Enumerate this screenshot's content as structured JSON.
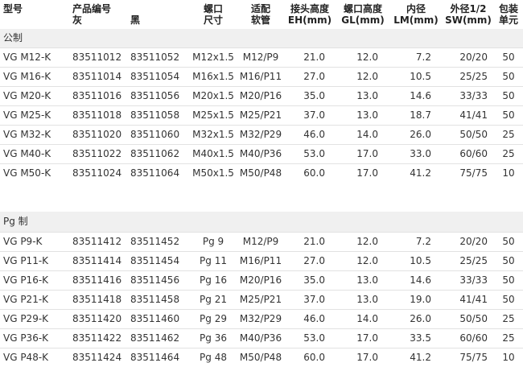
{
  "header": {
    "model": "型号",
    "code_title": "产品编号",
    "grey": "灰",
    "black": "黑",
    "thread_top": "螺口",
    "thread_bottom": "尺寸",
    "hose_top": "适配",
    "hose_bottom": "软管",
    "eh_top": "接头高度",
    "eh_bottom": "EH(mm)",
    "gl_top": "螺口高度",
    "gl_bottom": "GL(mm)",
    "lm_top": "内径",
    "lm_bottom": "LM(mm)",
    "sw_top": "外径1/2",
    "sw_bottom": "SW(mm)",
    "pack_top": "包装",
    "pack_bottom": "单元"
  },
  "sections": [
    {
      "title": "公制",
      "rows": [
        [
          "VG M12-K",
          "83511012",
          "83511052",
          "M12x1.5",
          "M12/P9",
          "21.0",
          "12.0",
          "7.2",
          "20/20",
          "50"
        ],
        [
          "VG M16-K",
          "83511014",
          "83511054",
          "M16x1.5",
          "M16/P11",
          "27.0",
          "12.0",
          "10.5",
          "25/25",
          "50"
        ],
        [
          "VG M20-K",
          "83511016",
          "83511056",
          "M20x1.5",
          "M20/P16",
          "35.0",
          "13.0",
          "14.6",
          "33/33",
          "50"
        ],
        [
          "VG M25-K",
          "83511018",
          "83511058",
          "M25x1.5",
          "M25/P21",
          "37.0",
          "13.0",
          "18.7",
          "41/41",
          "50"
        ],
        [
          "VG M32-K",
          "83511020",
          "83511060",
          "M32x1.5",
          "M32/P29",
          "46.0",
          "14.0",
          "26.0",
          "50/50",
          "25"
        ],
        [
          "VG M40-K",
          "83511022",
          "83511062",
          "M40x1.5",
          "M40/P36",
          "53.0",
          "17.0",
          "33.0",
          "60/60",
          "25"
        ],
        [
          "VG M50-K",
          "83511024",
          "83511064",
          "M50x1.5",
          "M50/P48",
          "60.0",
          "17.0",
          "41.2",
          "75/75",
          "10"
        ]
      ]
    },
    {
      "title": "Pg 制",
      "rows": [
        [
          "VG P9-K",
          "83511412",
          "83511452",
          "Pg 9",
          "M12/P9",
          "21.0",
          "12.0",
          "7.2",
          "20/20",
          "50"
        ],
        [
          "VG P11-K",
          "83511414",
          "83511454",
          "Pg 11",
          "M16/P11",
          "27.0",
          "12.0",
          "10.5",
          "25/25",
          "50"
        ],
        [
          "VG P16-K",
          "83511416",
          "83511456",
          "Pg 16",
          "M20/P16",
          "35.0",
          "13.0",
          "14.6",
          "33/33",
          "50"
        ],
        [
          "VG P21-K",
          "83511418",
          "83511458",
          "Pg 21",
          "M25/P21",
          "37.0",
          "13.0",
          "19.0",
          "41/41",
          "50"
        ],
        [
          "VG P29-K",
          "83511420",
          "83511460",
          "Pg 29",
          "M32/P29",
          "46.0",
          "14.0",
          "26.0",
          "50/50",
          "25"
        ],
        [
          "VG P36-K",
          "83511422",
          "83511462",
          "Pg 36",
          "M40/P36",
          "53.0",
          "17.0",
          "33.5",
          "60/60",
          "25"
        ],
        [
          "VG P48-K",
          "83511424",
          "83511464",
          "Pg 48",
          "M50/P48",
          "60.0",
          "17.0",
          "41.2",
          "75/75",
          "10"
        ]
      ]
    }
  ]
}
